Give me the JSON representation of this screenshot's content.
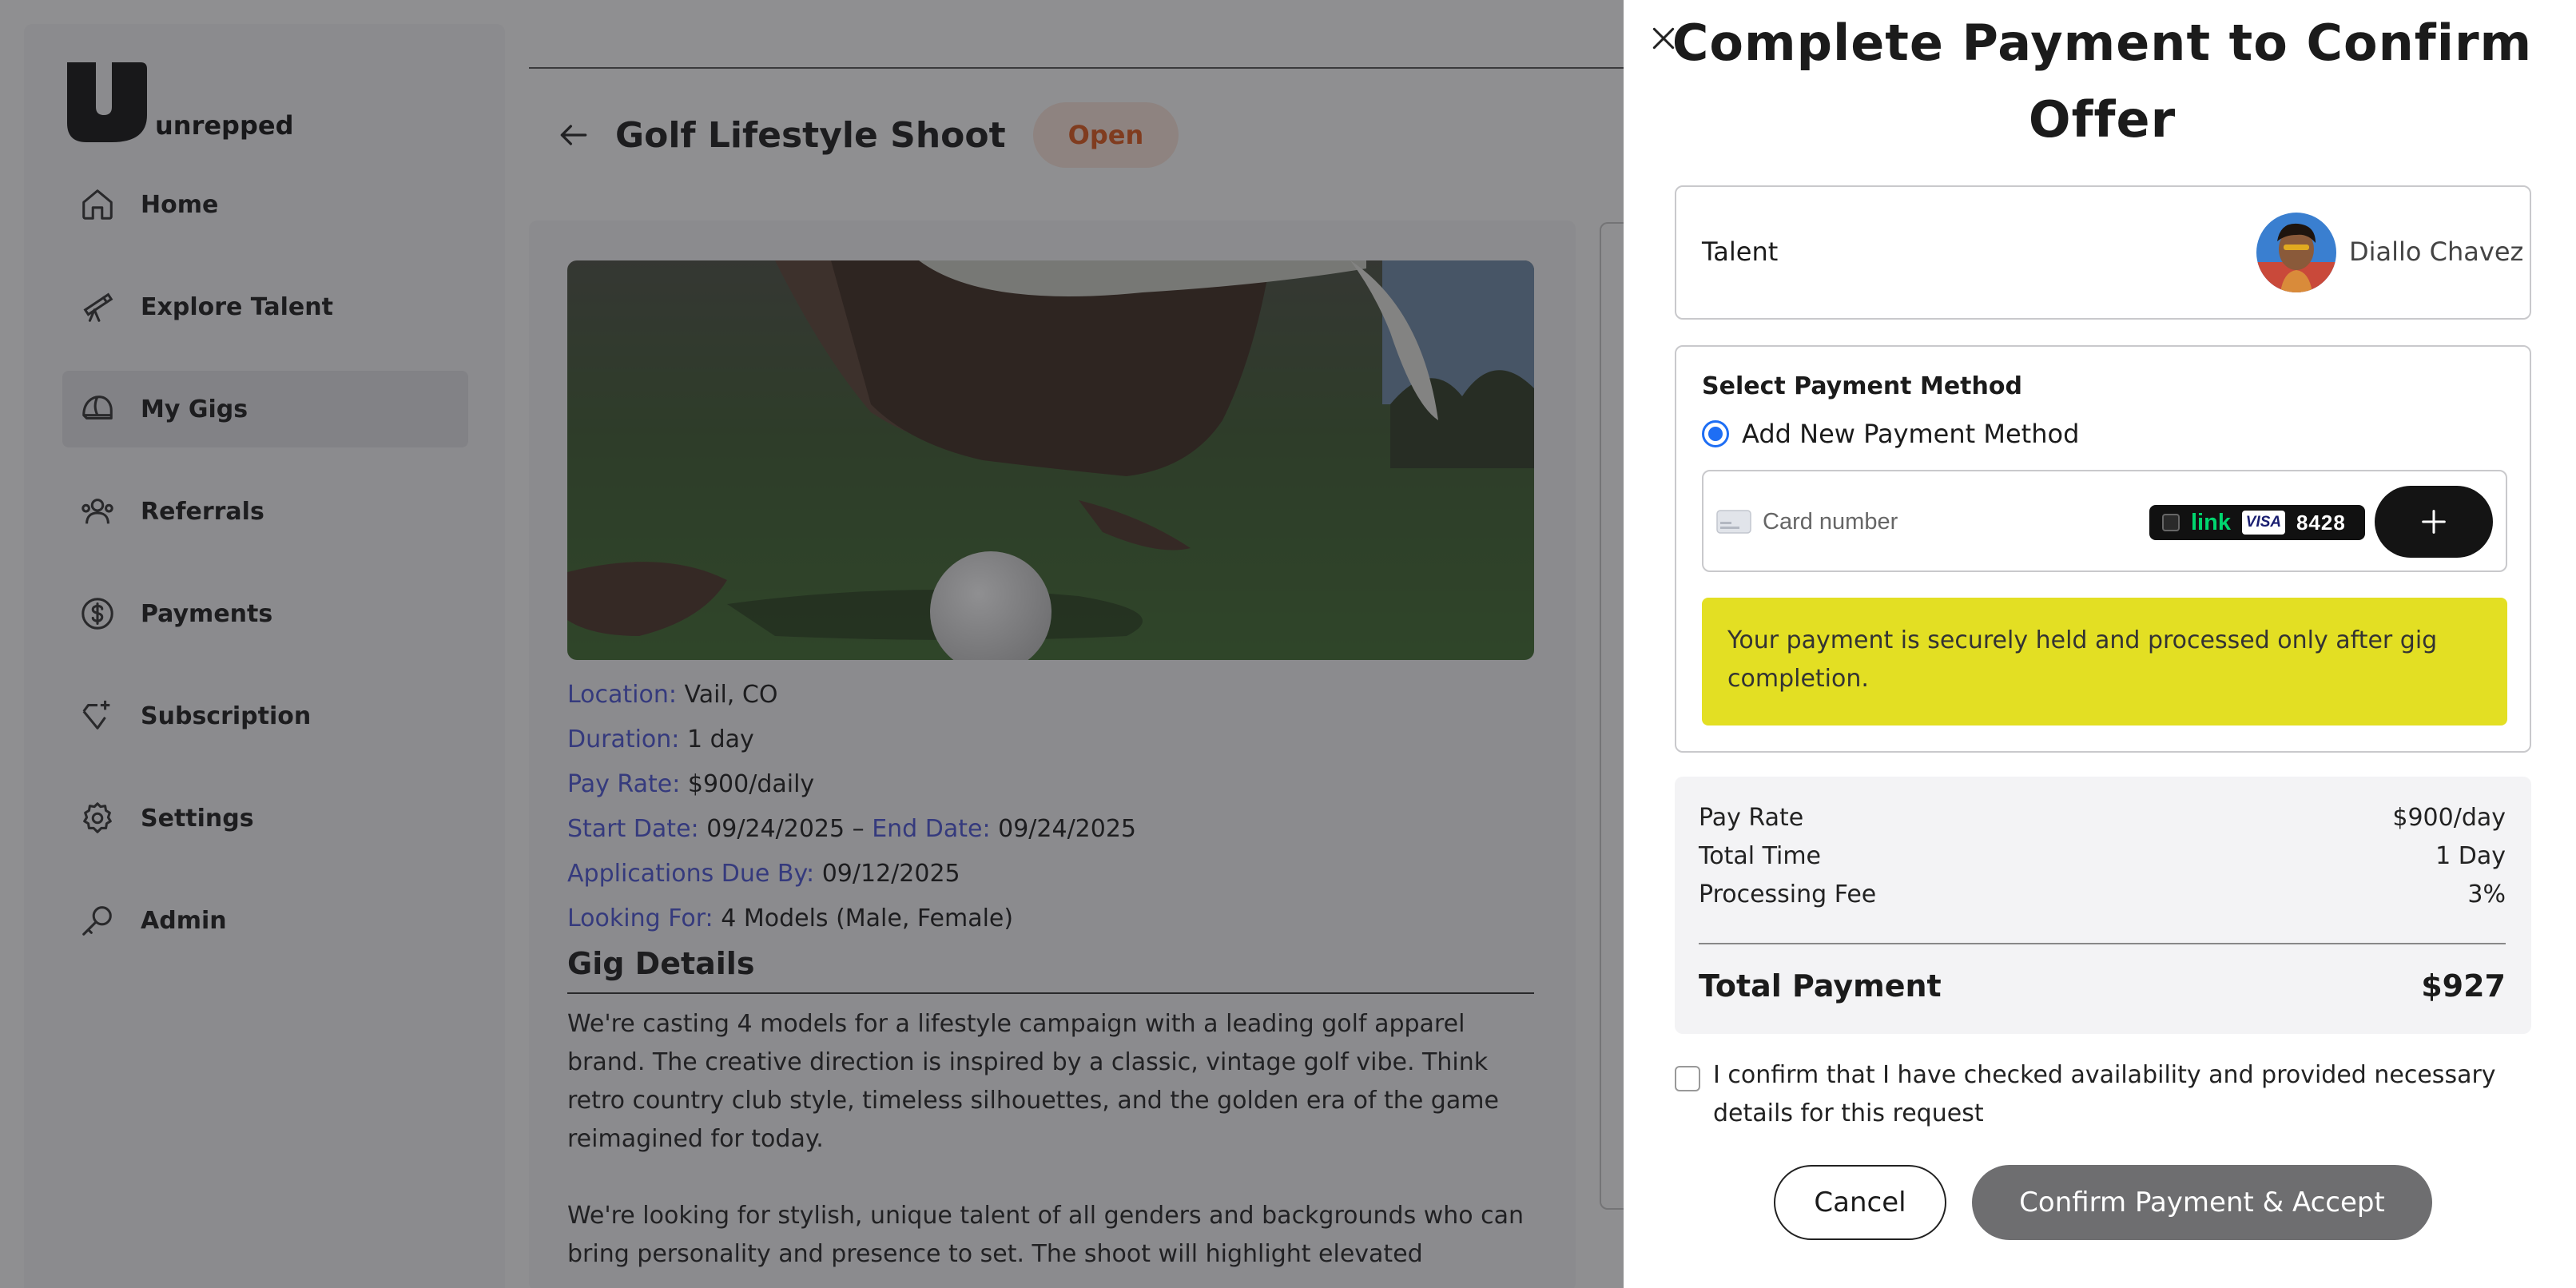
{
  "app": {
    "logo_text": "unrepped"
  },
  "sidebar": {
    "items": [
      {
        "label": "Home",
        "icon": "home-icon"
      },
      {
        "label": "Explore Talent",
        "icon": "telescope-icon"
      },
      {
        "label": "My Gigs",
        "icon": "helmet-icon",
        "active": true
      },
      {
        "label": "Referrals",
        "icon": "users-icon"
      },
      {
        "label": "Payments",
        "icon": "dollar-icon"
      },
      {
        "label": "Subscription",
        "icon": "diamond-sparkle-icon"
      },
      {
        "label": "Settings",
        "icon": "gear-icon"
      },
      {
        "label": "Admin",
        "icon": "key-icon"
      }
    ]
  },
  "gig": {
    "title": "Golf Lifestyle Shoot",
    "status": "Open",
    "location_label": "Location:",
    "location": "Vail, CO",
    "duration_label": "Duration:",
    "duration": "1 day",
    "pay_rate_label": "Pay Rate:",
    "pay_rate": "$900/daily",
    "start_date_label": "Start Date:",
    "start_date": "09/24/2025",
    "date_separator": "–",
    "end_date_label": "End Date:",
    "end_date": "09/24/2025",
    "applications_due_label": "Applications Due By:",
    "applications_due": "09/12/2025",
    "looking_for_label": "Looking For:",
    "looking_for": "4 Models (Male, Female)",
    "details_title": "Gig Details",
    "details_p1": "We're casting 4 models for a lifestyle campaign with a leading golf apparel brand. The creative direction is inspired by a classic, vintage golf vibe. Think retro country club style, timeless silhouettes, and the golden era of the game reimagined for today.",
    "details_p2": "We're looking for stylish, unique talent of all genders and backgrounds who can bring personality and presence to set. The shoot will highlight elevated"
  },
  "modal": {
    "title": "Complete Payment to Confirm Offer",
    "talent_label": "Talent",
    "talent_name": "Diallo Chavez",
    "payment_method_title": "Select Payment Method",
    "add_new_label": "Add New Payment Method",
    "card_placeholder": "Card number",
    "link_label": "link",
    "visa_label": "VISA",
    "card_last4": "8428",
    "notice": "Your payment is securely held and processed only after gig completion.",
    "summary": {
      "pay_rate_label": "Pay Rate",
      "pay_rate_value": "$900/day",
      "total_time_label": "Total Time",
      "total_time_value": "1 Day",
      "fee_label": "Processing Fee",
      "fee_value": "3%",
      "total_label": "Total Payment",
      "total_value": "$927"
    },
    "confirm_text": "I confirm that I have checked availability and provided necessary details for this request",
    "cancel_label": "Cancel",
    "accept_label": "Confirm Payment & Accept"
  },
  "colors": {
    "accent_blue": "#1e6ef4",
    "status_orange": "#e0581b",
    "notice_yellow": "#e3df23",
    "link_green": "#00d66f",
    "label_blue": "#4a55d6"
  }
}
